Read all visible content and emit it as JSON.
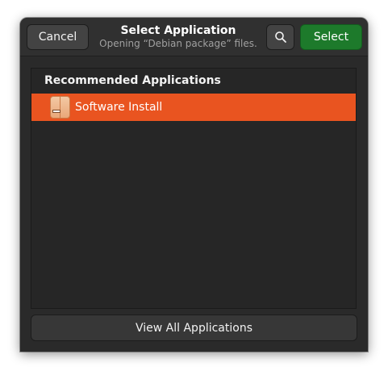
{
  "header": {
    "cancel_label": "Cancel",
    "title": "Select Application",
    "subtitle": "Opening “Debian package” files.",
    "search_icon": "search-icon",
    "select_label": "Select"
  },
  "list": {
    "section_heading": "Recommended Applications",
    "items": [
      {
        "label": "Software Install",
        "icon": "software-install-icon",
        "selected": true
      }
    ]
  },
  "footer": {
    "view_all_label": "View All Applications"
  },
  "colors": {
    "accent": "#e95420",
    "select_button": "#1d7a2b",
    "window_bg": "#2a2a2a"
  }
}
